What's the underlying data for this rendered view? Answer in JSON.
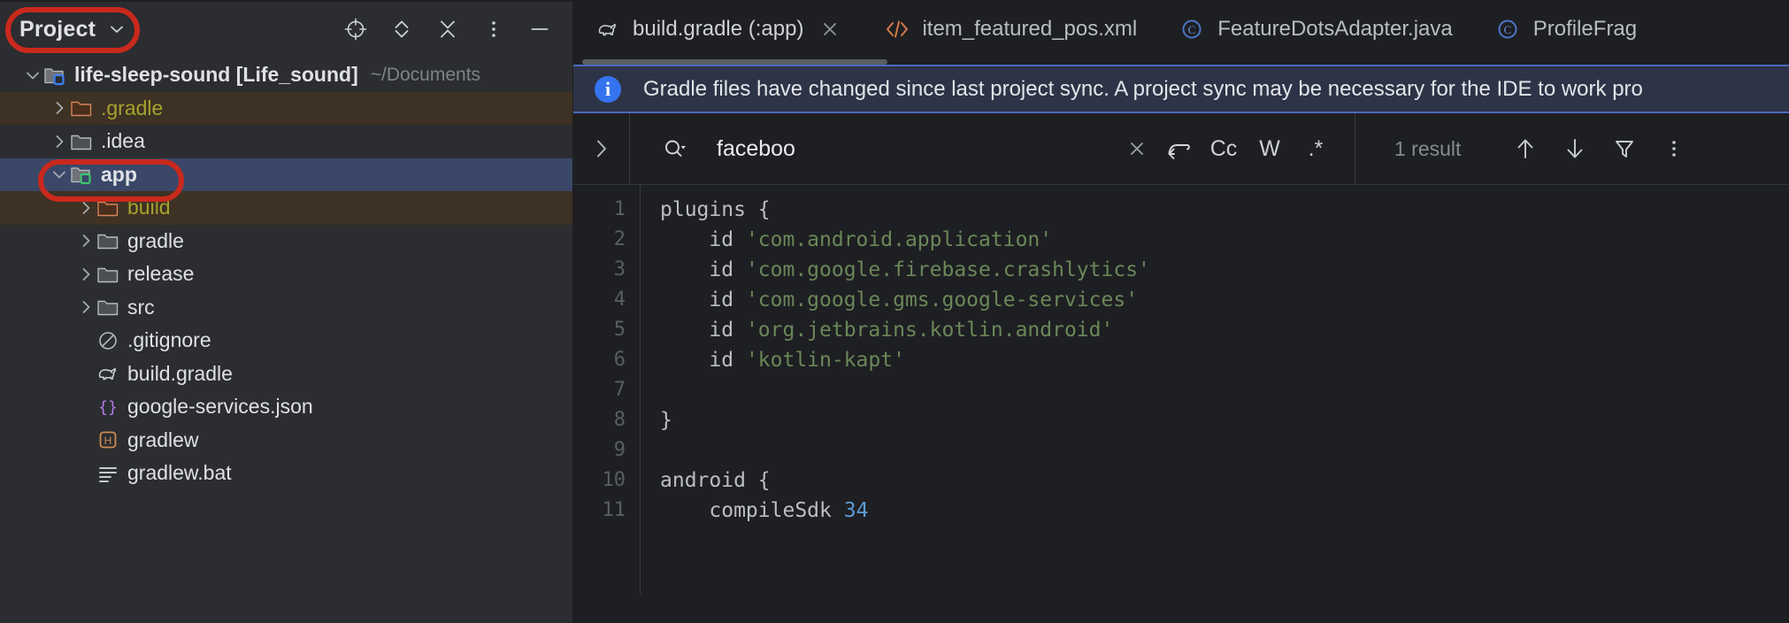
{
  "project_panel": {
    "title": "Project",
    "title_chevron_icon": "chevron-down-icon",
    "header_actions": [
      {
        "name": "select-opened-file-icon",
        "icon": "crosshair-target-icon"
      },
      {
        "name": "expand-collapse-icon",
        "icon": "chevron-up-down-icon"
      },
      {
        "name": "collapse-all-icon",
        "icon": "collapse-arrows-icon"
      },
      {
        "name": "options-icon",
        "icon": "vertical-dots-icon"
      },
      {
        "name": "hide-panel-icon",
        "icon": "minus-icon"
      }
    ],
    "tree": [
      {
        "label": "life-sleep-sound [Life_sound]",
        "suffix": "~/Documents",
        "indent": 0,
        "arrow": "expanded",
        "icon": "module-folder-blue-icon",
        "style": "bold",
        "state": "normal"
      },
      {
        "label": ".gradle",
        "suffix": "",
        "indent": 1,
        "arrow": "collapsed",
        "icon": "folder-excluded-icon",
        "style": "olive",
        "state": "modified"
      },
      {
        "label": ".idea",
        "suffix": "",
        "indent": 1,
        "arrow": "collapsed",
        "icon": "folder-icon",
        "style": "normal",
        "state": "normal"
      },
      {
        "label": "app",
        "suffix": "",
        "indent": 1,
        "arrow": "expanded",
        "icon": "module-folder-green-icon",
        "style": "bold",
        "state": "selected"
      },
      {
        "label": "build",
        "suffix": "",
        "indent": 2,
        "arrow": "collapsed",
        "icon": "folder-excluded-icon",
        "style": "olive",
        "state": "modified"
      },
      {
        "label": "gradle",
        "suffix": "",
        "indent": 2,
        "arrow": "collapsed",
        "icon": "folder-icon",
        "style": "normal",
        "state": "normal"
      },
      {
        "label": "release",
        "suffix": "",
        "indent": 2,
        "arrow": "collapsed",
        "icon": "folder-icon",
        "style": "normal",
        "state": "normal"
      },
      {
        "label": "src",
        "suffix": "",
        "indent": 2,
        "arrow": "collapsed",
        "icon": "folder-icon",
        "style": "normal",
        "state": "normal"
      },
      {
        "label": ".gitignore",
        "suffix": "",
        "indent": 2,
        "arrow": "none",
        "icon": "gitignore-icon",
        "style": "normal",
        "state": "normal"
      },
      {
        "label": "build.gradle",
        "suffix": "",
        "indent": 2,
        "arrow": "none",
        "icon": "gradle-elephant-icon",
        "style": "normal",
        "state": "normal"
      },
      {
        "label": "google-services.json",
        "suffix": "",
        "indent": 2,
        "arrow": "none",
        "icon": "json-braces-icon",
        "style": "normal",
        "state": "normal"
      },
      {
        "label": "gradlew",
        "suffix": "",
        "indent": 2,
        "arrow": "none",
        "icon": "shell-script-h-icon",
        "style": "normal",
        "state": "normal"
      },
      {
        "label": "gradlew.bat",
        "suffix": "",
        "indent": 2,
        "arrow": "none",
        "icon": "text-lines-icon",
        "style": "normal",
        "state": "normal"
      }
    ]
  },
  "annotations": [
    {
      "name": "annotation-oval-project",
      "color": "#c9291d",
      "target": "Project"
    },
    {
      "name": "annotation-oval-app",
      "color": "#c9291d",
      "target": "app"
    }
  ],
  "editor": {
    "tabs": [
      {
        "label": "build.gradle (:app)",
        "icon": "gradle-elephant-icon",
        "active": true,
        "closable": true
      },
      {
        "label": "item_featured_pos.xml",
        "icon": "xml-tag-icon",
        "active": false,
        "closable": false
      },
      {
        "label": "FeatureDotsAdapter.java",
        "icon": "java-class-icon",
        "active": false,
        "closable": false
      },
      {
        "label": "ProfileFrag",
        "icon": "java-class-icon",
        "active": false,
        "closable": false
      }
    ],
    "close_icon": "close-icon",
    "banner": {
      "icon": "info-icon",
      "icon_glyph": "i",
      "text": "Gradle files have changed since last project sync. A project sync may be necessary for the IDE to work pro"
    },
    "find": {
      "expand_icon": "chevron-right-icon",
      "search_icon": "search-dropdown-icon",
      "value": "faceboo",
      "placeholder": "Search",
      "clear_icon": "close-icon",
      "newline_icon": "multiline-return-icon",
      "toggles": [
        {
          "label": "Cc",
          "name": "match-case-toggle"
        },
        {
          "label": "W",
          "name": "words-toggle"
        },
        {
          "label": ".*",
          "name": "regex-toggle"
        }
      ],
      "result_count": "1 result",
      "nav": [
        {
          "name": "previous-occurrence-icon",
          "glyph": "arrow-up-icon"
        },
        {
          "name": "next-occurrence-icon",
          "glyph": "arrow-down-icon"
        },
        {
          "name": "filter-icon",
          "glyph": "funnel-icon"
        },
        {
          "name": "find-options-icon",
          "glyph": "vertical-dots-icon"
        }
      ]
    },
    "code": {
      "line_numbers": [
        "1",
        "2",
        "3",
        "4",
        "5",
        "6",
        "7",
        "8",
        "9",
        "10",
        "11"
      ],
      "lines": [
        [
          {
            "t": "plugins {",
            "c": "plain"
          }
        ],
        [
          {
            "t": "    id ",
            "c": "plain"
          },
          {
            "t": "'com.android.application'",
            "c": "string"
          }
        ],
        [
          {
            "t": "    id ",
            "c": "plain"
          },
          {
            "t": "'com.google.firebase.crashlytics'",
            "c": "string"
          }
        ],
        [
          {
            "t": "    id ",
            "c": "plain"
          },
          {
            "t": "'com.google.gms.google-services'",
            "c": "string"
          }
        ],
        [
          {
            "t": "    id ",
            "c": "plain"
          },
          {
            "t": "'org.jetbrains.kotlin.android'",
            "c": "string"
          }
        ],
        [
          {
            "t": "    id ",
            "c": "plain"
          },
          {
            "t": "'kotlin-kapt'",
            "c": "string"
          }
        ],
        [
          {
            "t": "",
            "c": "plain"
          }
        ],
        [
          {
            "t": "}",
            "c": "plain"
          }
        ],
        [
          {
            "t": "",
            "c": "plain"
          }
        ],
        [
          {
            "t": "android {",
            "c": "plain"
          }
        ],
        [
          {
            "t": "    compileSdk ",
            "c": "plain"
          },
          {
            "t": "34",
            "c": "number"
          }
        ]
      ]
    }
  },
  "colors": {
    "panel_bg": "#2b2d30",
    "editor_bg": "#1e1f22",
    "selection_blue": "#3a4768",
    "modified_brown": "#3d3223",
    "banner_bg": "#2d3447",
    "banner_border": "#4a6bbd",
    "accent_blue": "#3574f0",
    "string_green": "#6a8759",
    "annotation_red": "#c9291d"
  }
}
